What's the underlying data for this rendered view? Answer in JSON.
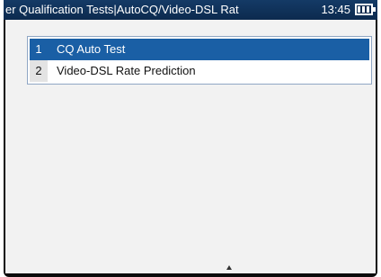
{
  "header": {
    "title": "er Qualification Tests|AutoCQ/Video-DSL Rat",
    "time": "13:45"
  },
  "menu": {
    "items": [
      {
        "number": "1",
        "label": "CQ Auto Test"
      },
      {
        "number": "2",
        "label": "Video-DSL Rate Prediction"
      }
    ],
    "selected_index": 0
  },
  "colors": {
    "titlebar": "#143a66",
    "selected_row": "#1a5fa5",
    "screen_bg": "#f2f2f2"
  },
  "icons": {
    "battery": "battery-icon"
  }
}
